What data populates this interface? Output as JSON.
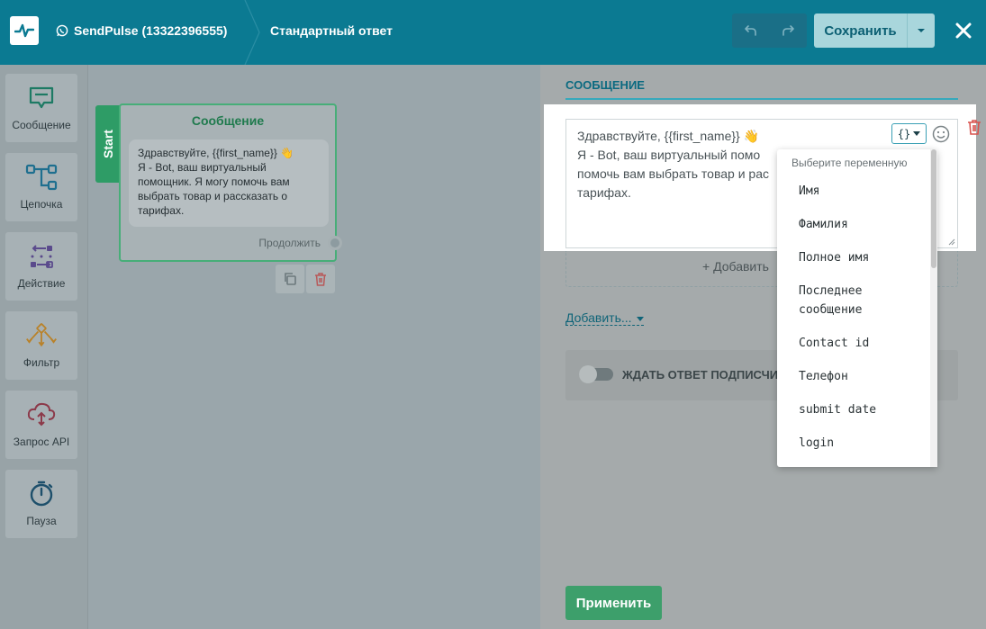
{
  "topbar": {
    "bot_name": "SendPulse (13322396555)",
    "flow_name": "Стандартный ответ",
    "save_label": "Сохранить"
  },
  "sidebar": {
    "items": [
      {
        "label": "Сообщение",
        "icon": "message-icon"
      },
      {
        "label": "Цепочка",
        "icon": "chain-icon"
      },
      {
        "label": "Действие",
        "icon": "action-icon"
      },
      {
        "label": "Фильтр",
        "icon": "filter-icon"
      },
      {
        "label": "Запрос API",
        "icon": "api-request-icon"
      },
      {
        "label": "Пауза",
        "icon": "pause-timer-icon"
      }
    ]
  },
  "canvas": {
    "start_label": "Start",
    "node": {
      "title": "Сообщение",
      "lines": [
        "Здравствуйте,  {{first_name}} 👋",
        "Я - Bot, ваш виртуальный",
        "помощник. Я могу помочь вам",
        "выбрать товар и рассказать о",
        "тарифах."
      ],
      "continue_label": "Продолжить"
    }
  },
  "panel": {
    "tab_label": "СООБЩЕНИЕ",
    "editor_lines": [
      "Здравствуйте,  {{first_name}} 👋",
      "Я - Bot, ваш виртуальный  помо",
      "помочь вам выбрать товар и рас",
      "тарифах."
    ],
    "var_button": "{}",
    "add_button_label": "+ Добавить",
    "add_more_label": "Добавить...",
    "wait_label": "ЖДАТЬ ОТВЕТ ПОДПИСЧИ",
    "apply_label": "Применить"
  },
  "dropdown": {
    "header": "Выберите переменную",
    "items": [
      "Имя",
      "Фамилия",
      "Полное имя",
      "Последнее\nсообщение",
      "Contact id",
      "Телефон",
      "submit date",
      "login"
    ]
  },
  "colors": {
    "topbar": "#0b7a92",
    "accent_green": "#3d9f6b",
    "delete_red": "#d9534f"
  }
}
